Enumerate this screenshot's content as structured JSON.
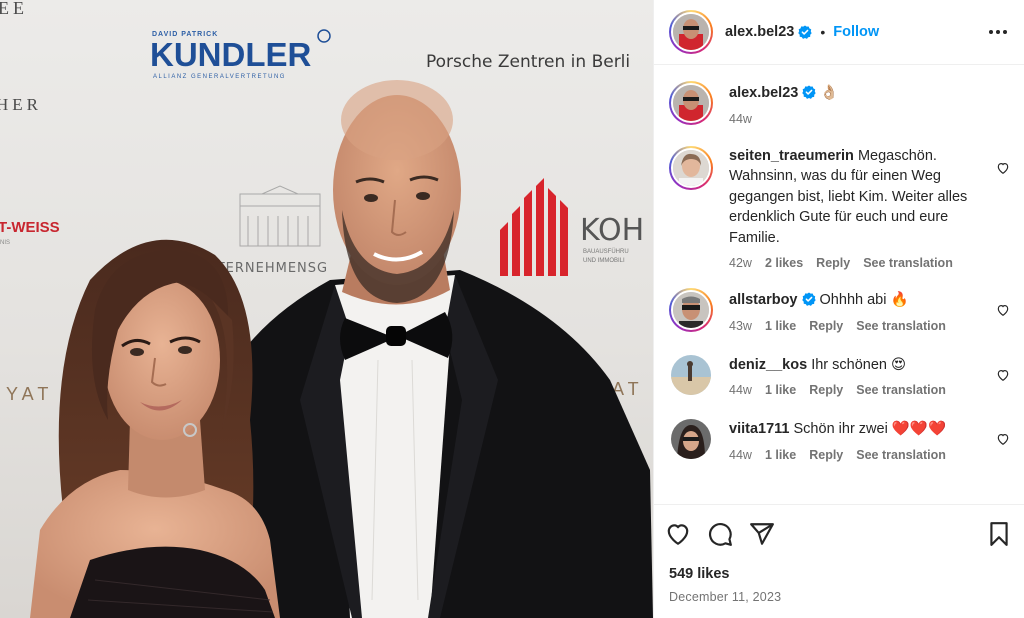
{
  "post": {
    "username": "alex.bel23",
    "follow_label": "Follow",
    "separator": "•",
    "caption_emoji": "👌🏼",
    "caption_age": "44w",
    "likes": "549 likes",
    "date": "December 11, 2023"
  },
  "backdrop": {
    "sponsor_small": "DAVID PATRICK",
    "sponsor_big": "KUNDLER",
    "sponsor_sub": "ALLIANZ GENERALVERTRETUNG",
    "porsche": "Porsche Zentren in Berli",
    "left_top": "EE",
    "left_mid": "HER",
    "weiss": "T-WEISS",
    "weiss_sub": "NIS",
    "unternehmen": "NTERNEHMENSG",
    "yat_left": "IYAT",
    "yat_right": "AT",
    "koh": "KOH",
    "koh_sub1": "BAUAUSFÜHRU",
    "koh_sub2": "UND IMMOBILI"
  },
  "comments": [
    {
      "user": "seiten_traeumerin",
      "verified": false,
      "text": "Megaschön. Wahnsinn, was du für einen Weg gegangen bist, liebt Kim. Weiter alles erdenklich Gute für euch und eure Familie.",
      "age": "42w",
      "likes": "2 likes",
      "reply": "Reply",
      "translate": "See translation"
    },
    {
      "user": "allstarboy",
      "verified": true,
      "text": "Ohhhh abi 🔥",
      "age": "43w",
      "likes": "1 like",
      "reply": "Reply",
      "translate": "See translation"
    },
    {
      "user": "deniz__kos",
      "verified": false,
      "text": "Ihr schönen 😍",
      "age": "44w",
      "likes": "1 like",
      "reply": "Reply",
      "translate": "See translation"
    },
    {
      "user": "viita1711",
      "verified": false,
      "text": "Schön ihr zwei ❤️❤️❤️",
      "age": "44w",
      "likes": "1 like",
      "reply": "Reply",
      "translate": "See translation"
    }
  ],
  "icons": {
    "more": "more-options-icon",
    "verified": "verified-badge-icon",
    "like": "heart-icon",
    "comment": "comment-icon",
    "share": "share-icon",
    "save": "bookmark-icon"
  },
  "colors": {
    "accent": "#0095f6",
    "verified": "#0095f6",
    "muted": "#737373",
    "text": "#262626"
  }
}
